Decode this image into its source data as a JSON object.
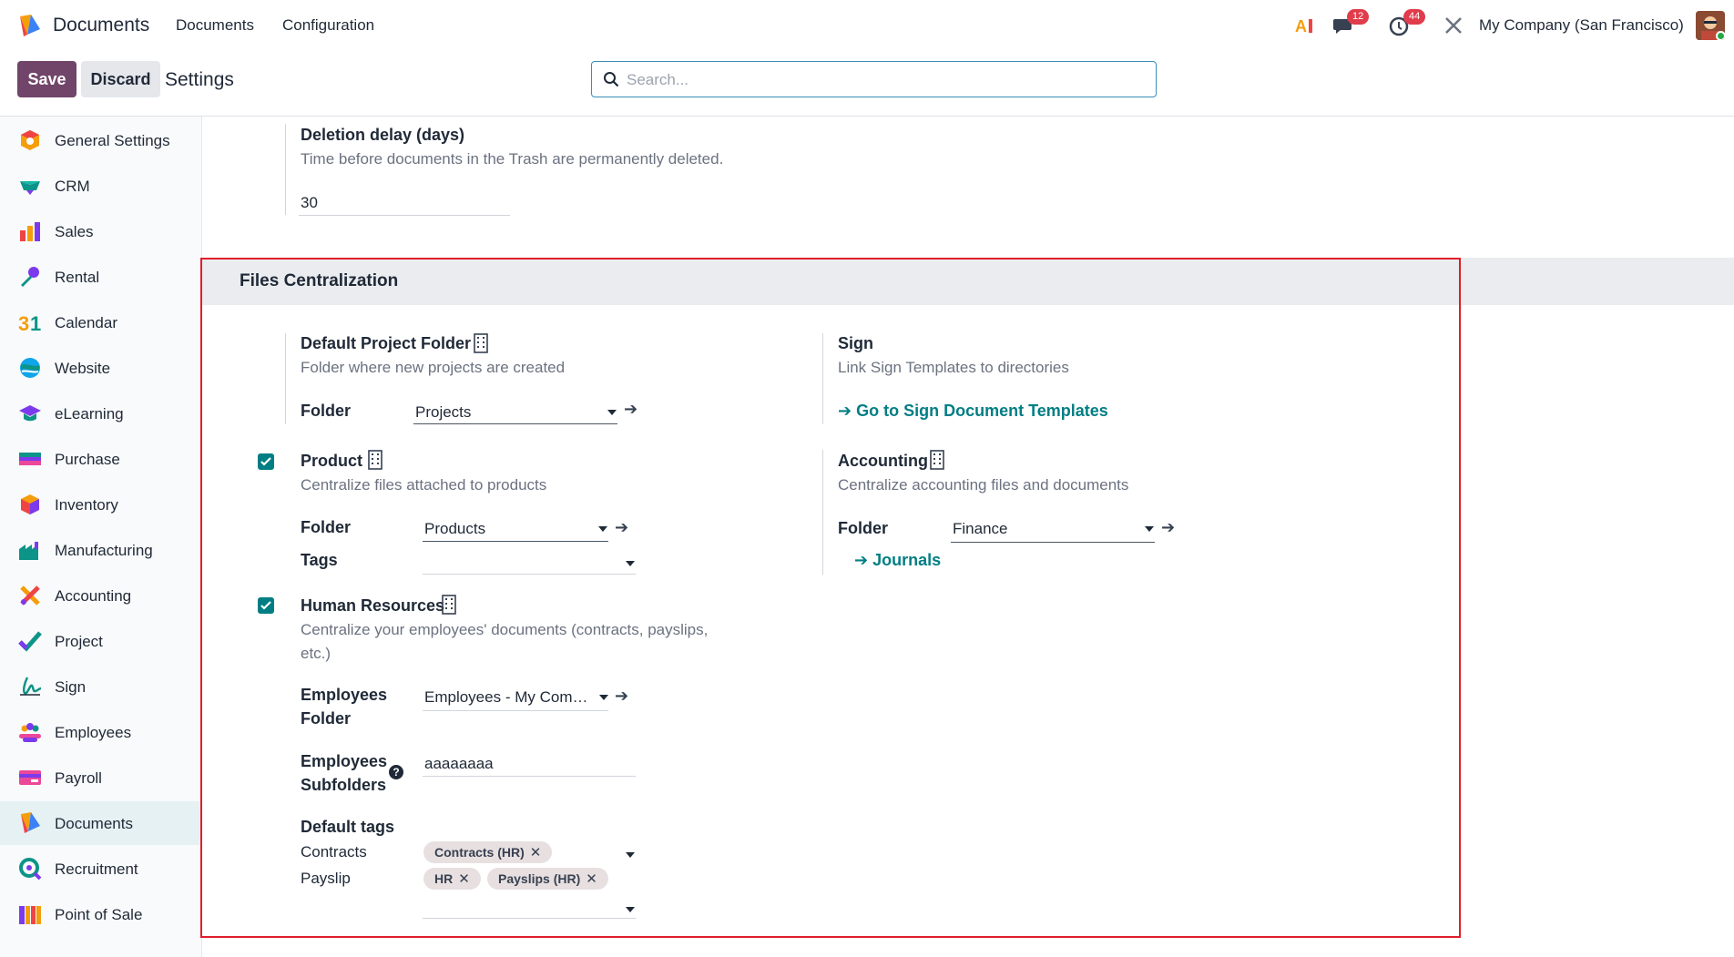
{
  "app": {
    "name": "Documents",
    "brand_color": "#71456a",
    "accent_color": "#017e84"
  },
  "topnav": {
    "menu": [
      "Documents",
      "Configuration"
    ],
    "chat_count": "12",
    "activity_count": "44",
    "company": "My Company (San Francisco)"
  },
  "control": {
    "save_label": "Save",
    "discard_label": "Discard",
    "breadcrumb": "Settings",
    "search_placeholder": "Search..."
  },
  "sidebar": {
    "items": [
      {
        "label": "General Settings",
        "icon": "general-settings-icon"
      },
      {
        "label": "CRM",
        "icon": "crm-icon"
      },
      {
        "label": "Sales",
        "icon": "sales-icon"
      },
      {
        "label": "Rental",
        "icon": "rental-icon"
      },
      {
        "label": "Calendar",
        "icon": "calendar-icon"
      },
      {
        "label": "Website",
        "icon": "website-icon"
      },
      {
        "label": "eLearning",
        "icon": "elearning-icon"
      },
      {
        "label": "Purchase",
        "icon": "purchase-icon"
      },
      {
        "label": "Inventory",
        "icon": "inventory-icon"
      },
      {
        "label": "Manufacturing",
        "icon": "manufacturing-icon"
      },
      {
        "label": "Accounting",
        "icon": "accounting-icon"
      },
      {
        "label": "Project",
        "icon": "project-icon"
      },
      {
        "label": "Sign",
        "icon": "sign-icon"
      },
      {
        "label": "Employees",
        "icon": "employees-icon"
      },
      {
        "label": "Payroll",
        "icon": "payroll-icon"
      },
      {
        "label": "Documents",
        "icon": "documents-icon",
        "active": true
      },
      {
        "label": "Recruitment",
        "icon": "recruitment-icon"
      },
      {
        "label": "Point of Sale",
        "icon": "point-of-sale-icon"
      }
    ]
  },
  "deletion": {
    "title": "Deletion delay (days)",
    "desc": "Time before documents in the Trash are permanently deleted.",
    "value": "30"
  },
  "files": {
    "section_title": "Files Centralization",
    "project": {
      "title": "Default Project Folder",
      "desc": "Folder where new projects are created",
      "folder_label": "Folder",
      "folder_value": "Projects"
    },
    "sign": {
      "title": "Sign",
      "desc": "Link Sign Templates to directories",
      "link": "Go to Sign Document Templates"
    },
    "product": {
      "title": "Product",
      "checked": true,
      "desc": "Centralize files attached to products",
      "folder_label": "Folder",
      "folder_value": "Products",
      "tags_label": "Tags"
    },
    "accounting": {
      "title": "Accounting",
      "desc": "Centralize accounting files and documents",
      "folder_label": "Folder",
      "folder_value": "Finance",
      "link": "Journals"
    },
    "hr": {
      "title": "Human Resources",
      "checked": true,
      "desc_line1": "Centralize your employees' documents (contracts, payslips,",
      "desc_line2": "etc.)",
      "emp_folder_label_1": "Employees",
      "emp_folder_label_2": "Folder",
      "emp_folder_value": "Employees - My Com…",
      "emp_sub_label_1": "Employees",
      "emp_sub_label_2": "Subfolders",
      "emp_sub_value": "aaaaaaaa",
      "default_tags_label": "Default tags",
      "contracts_label": "Contracts",
      "contracts_tags": [
        "Contracts (HR)"
      ],
      "payslip_label": "Payslip",
      "payslip_tags": [
        "HR",
        "Payslips (HR)"
      ]
    }
  }
}
